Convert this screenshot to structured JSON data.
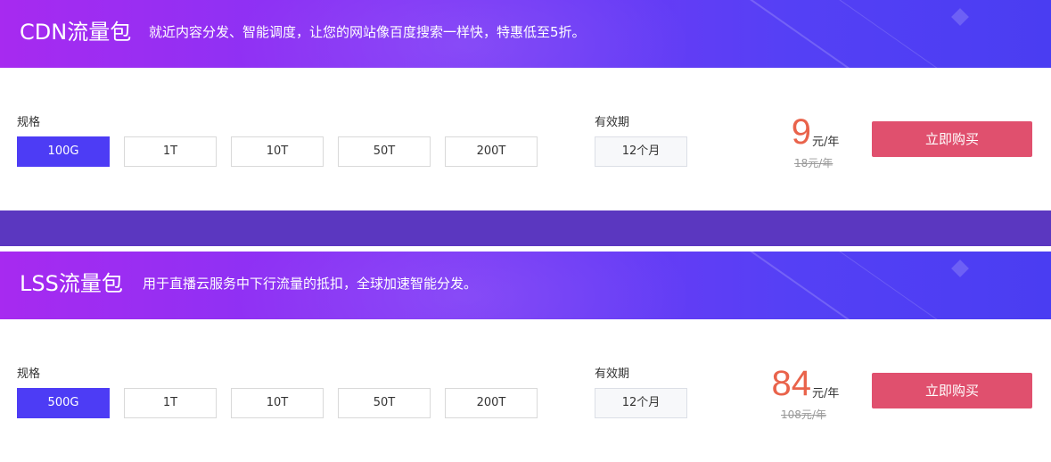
{
  "packages": [
    {
      "title": "CDN流量包",
      "description": "就近内容分发、智能调度，让您的网站像百度搜索一样快，特惠低至5折。",
      "spec_label": "规格",
      "options": [
        "100G",
        "1T",
        "10T",
        "50T",
        "200T"
      ],
      "selected_option": "100G",
      "period_label": "有效期",
      "period_value": "12个月",
      "price": "9",
      "price_unit": "元/年",
      "original_price": "18元/年",
      "buy_label": "立即购买"
    },
    {
      "title": "LSS流量包",
      "description": "用于直播云服务中下行流量的抵扣，全球加速智能分发。",
      "spec_label": "规格",
      "options": [
        "500G",
        "1T",
        "10T",
        "50T",
        "200T"
      ],
      "selected_option": "500G",
      "period_label": "有效期",
      "period_value": "12个月",
      "price": "84",
      "price_unit": "元/年",
      "original_price": "108元/年",
      "buy_label": "立即购买"
    }
  ],
  "colors": {
    "banner_start": "#a72af0",
    "banner_end": "#4a3df2",
    "separator": "#5b37c0",
    "selected_option": "#4d3cf5",
    "price": "#e9634b",
    "buy_button": "#e0506e"
  }
}
